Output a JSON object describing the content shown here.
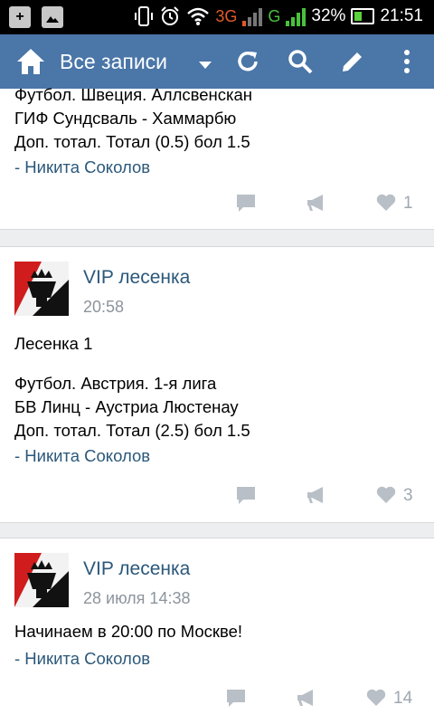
{
  "status_bar": {
    "network_3g": "3G",
    "network_g": "G",
    "battery": "32%",
    "time": "21:51"
  },
  "app_bar": {
    "title": "Все записи",
    "icons": [
      "home-icon",
      "refresh-icon",
      "search-icon",
      "edit-icon",
      "more-icon"
    ]
  },
  "posts": [
    {
      "lines": [
        "Футбол. Швеция. Аллсвенскан",
        "ГИФ Сундсваль - Хаммарбю",
        "Доп. тотал. Тотал (0.5) бол 1.5"
      ],
      "author": "- Никита Соколов",
      "likes": "1"
    },
    {
      "group": "VIP лесенка",
      "time": "20:58",
      "lines": [
        "Лесенка 1",
        "",
        "Футбол. Австрия. 1-я лига",
        "БВ Линц - Аустриа Люстенау",
        "Доп. тотал. Тотал (2.5) бол 1.5"
      ],
      "author": "- Никита Соколов",
      "likes": "3"
    },
    {
      "group": "VIP лесенка",
      "time": "28 июля 14:38",
      "lines": [
        "Начинаем в 20:00 по Москве!"
      ],
      "author": "- Никита Соколов",
      "likes": "14"
    }
  ],
  "colors": {
    "appbar": "#4a76a8",
    "link": "#2b587a",
    "icon_gray": "#b9bfc6"
  }
}
